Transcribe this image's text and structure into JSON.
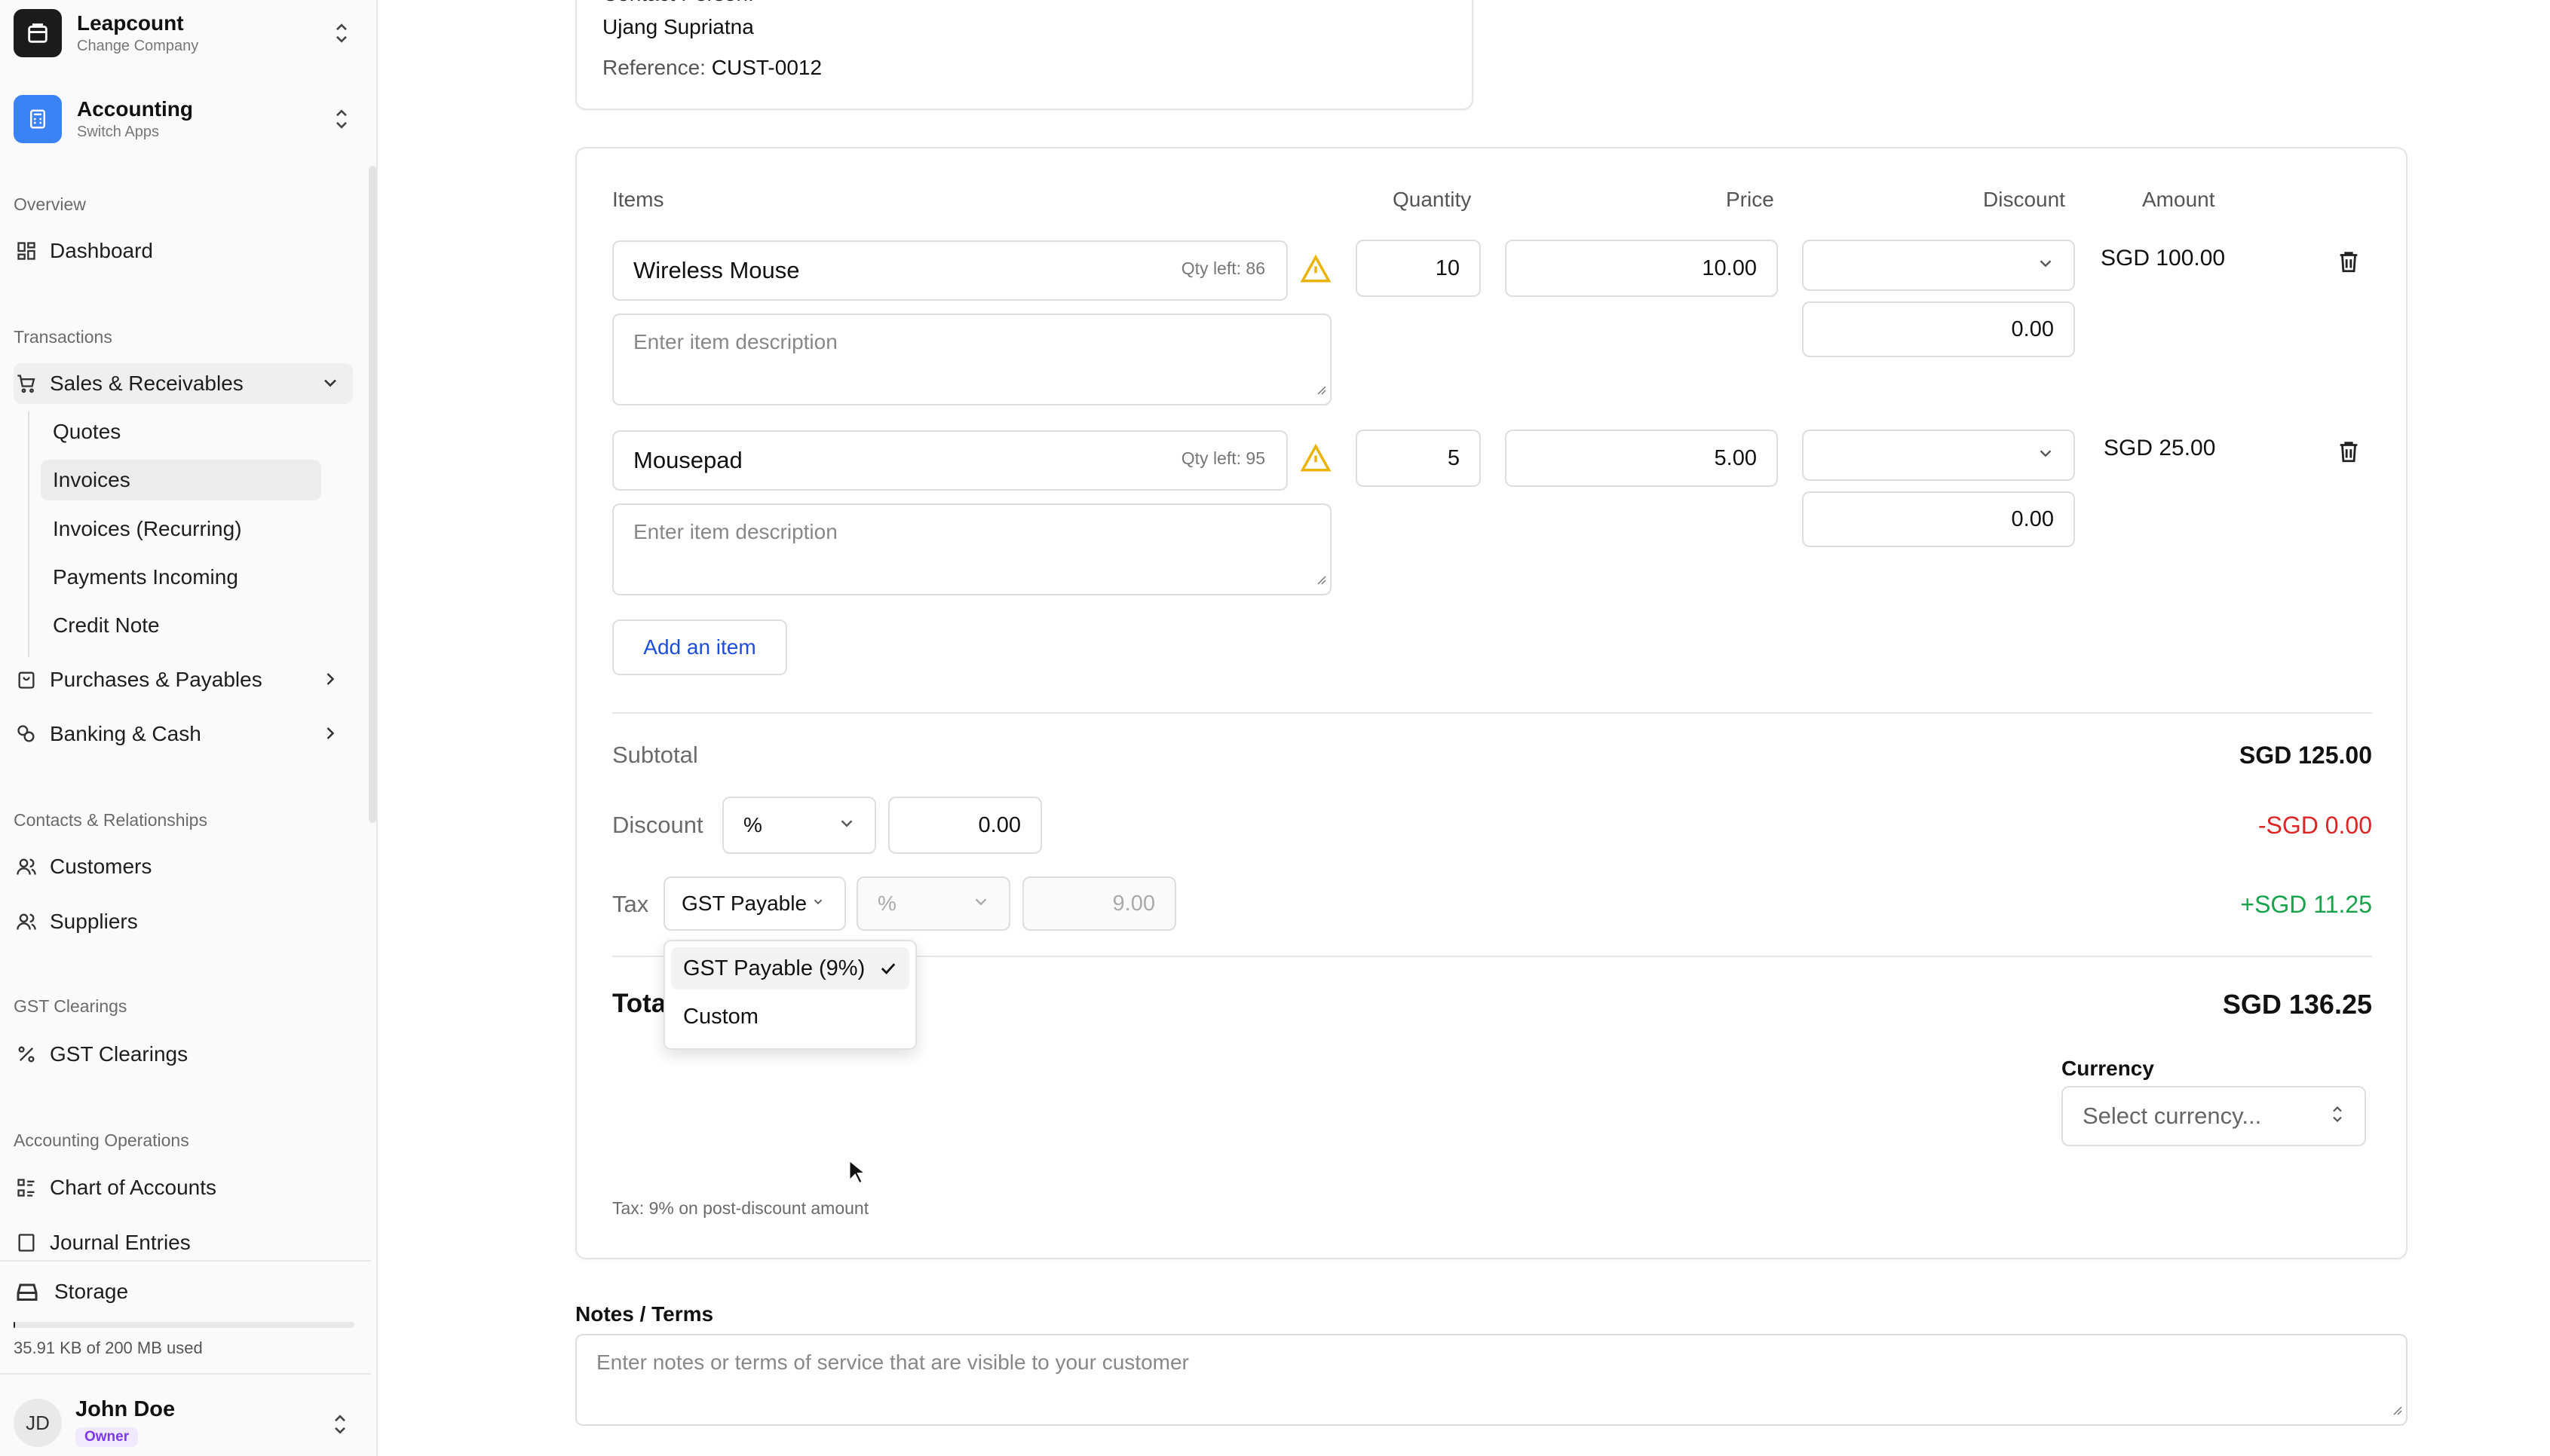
{
  "sidebar": {
    "company": {
      "name": "Leapcount",
      "sub": "Change Company"
    },
    "app": {
      "name": "Accounting",
      "sub": "Switch Apps"
    },
    "sections": {
      "overview": "Overview",
      "transactions": "Transactions",
      "contacts": "Contacts & Relationships",
      "gst": "GST Clearings",
      "operations": "Accounting Operations"
    },
    "items": {
      "dashboard": "Dashboard",
      "sales": "Sales & Receivables",
      "purchases": "Purchases & Payables",
      "banking": "Banking & Cash",
      "customers": "Customers",
      "suppliers": "Suppliers",
      "gst_clearings": "GST Clearings",
      "chart_of_accounts": "Chart of Accounts",
      "journal_entries": "Journal Entries"
    },
    "sales_sub": {
      "quotes": "Quotes",
      "invoices": "Invoices",
      "invoices_recurring": "Invoices (Recurring)",
      "payments_incoming": "Payments Incoming",
      "credit_note": "Credit Note"
    },
    "storage": {
      "label": "Storage",
      "usage": "35.91 KB of 200 MB used",
      "fraction": 0.0002
    },
    "user": {
      "initials": "JD",
      "name": "John Doe",
      "role": "Owner"
    }
  },
  "customer_card": {
    "contact_label": "Contact Person:",
    "contact_name": "Ujang Supriatna",
    "reference_label": "Reference:",
    "reference_value": "CUST-0012"
  },
  "items_table": {
    "headers": {
      "items": "Items",
      "quantity": "Quantity",
      "price": "Price",
      "discount": "Discount",
      "amount": "Amount"
    },
    "rows": [
      {
        "name": "Wireless Mouse",
        "qty_left": "Qty left: 86",
        "description_placeholder": "Enter item description",
        "quantity": "10",
        "price": "10.00",
        "discount_value": "0.00",
        "amount": "SGD 100.00"
      },
      {
        "name": "Mousepad",
        "qty_left": "Qty left: 95",
        "description_placeholder": "Enter item description",
        "quantity": "5",
        "price": "5.00",
        "discount_value": "0.00",
        "amount": "SGD 25.00"
      }
    ],
    "add_item_label": "Add an item"
  },
  "totals": {
    "subtotal_label": "Subtotal",
    "subtotal_value": "SGD 125.00",
    "discount_label": "Discount",
    "discount_type": "%",
    "discount_value": "0.00",
    "discount_amount": "-SGD 0.00",
    "tax_label": "Tax",
    "tax_select": "GST Payable",
    "tax_type": "%",
    "tax_rate": "9.00",
    "tax_amount": "+SGD 11.25",
    "total_label": "Total",
    "total_value": "SGD 136.25",
    "tax_note": "Tax: 9% on post-discount amount"
  },
  "tax_menu": {
    "options": [
      "GST Payable (9%)",
      "Custom"
    ],
    "selected": "GST Payable (9%)"
  },
  "currency": {
    "label": "Currency",
    "placeholder": "Select currency..."
  },
  "notes": {
    "label": "Notes / Terms",
    "placeholder": "Enter notes or terms of service that are visible to your customer"
  },
  "colors": {
    "accent_blue": "#1d4ed8",
    "negative_red": "#dc2626",
    "positive_green": "#16a34a",
    "warning_amber": "#eab308"
  }
}
